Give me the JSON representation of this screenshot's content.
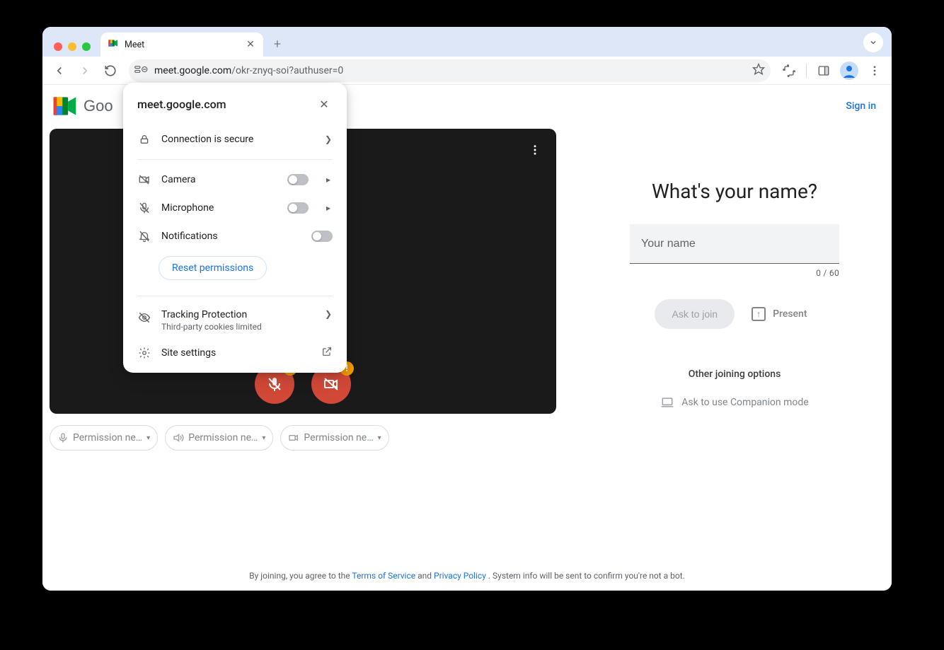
{
  "browser": {
    "tab_title": "Meet",
    "url_host": "meet.google.com",
    "url_path": "/okr-znyq-soi?authuser=0"
  },
  "site_popup": {
    "domain": "meet.google.com",
    "connection": "Connection is secure",
    "permissions": {
      "camera": "Camera",
      "microphone": "Microphone",
      "notifications": "Notifications"
    },
    "reset": "Reset permissions",
    "tracking_title": "Tracking Protection",
    "tracking_sub": "Third-party cookies limited",
    "site_settings": "Site settings"
  },
  "header": {
    "logo_text": "Goo",
    "brand_truncated": "Goo",
    "signin": "Sign in"
  },
  "chips": {
    "mic": "Permission ne…",
    "speaker": "Permission ne…",
    "camera": "Permission ne…"
  },
  "join": {
    "prompt": "What's your name?",
    "placeholder": "Your name",
    "counter": "0 / 60",
    "ask": "Ask to join",
    "present": "Present",
    "other": "Other joining options",
    "companion": "Ask to use Companion mode"
  },
  "footer": {
    "prefix": "By joining, you agree to the ",
    "tos": "Terms of Service",
    "and": " and ",
    "privacy": "Privacy Policy",
    "suffix": ". System info will be sent to confirm you're not a bot."
  }
}
